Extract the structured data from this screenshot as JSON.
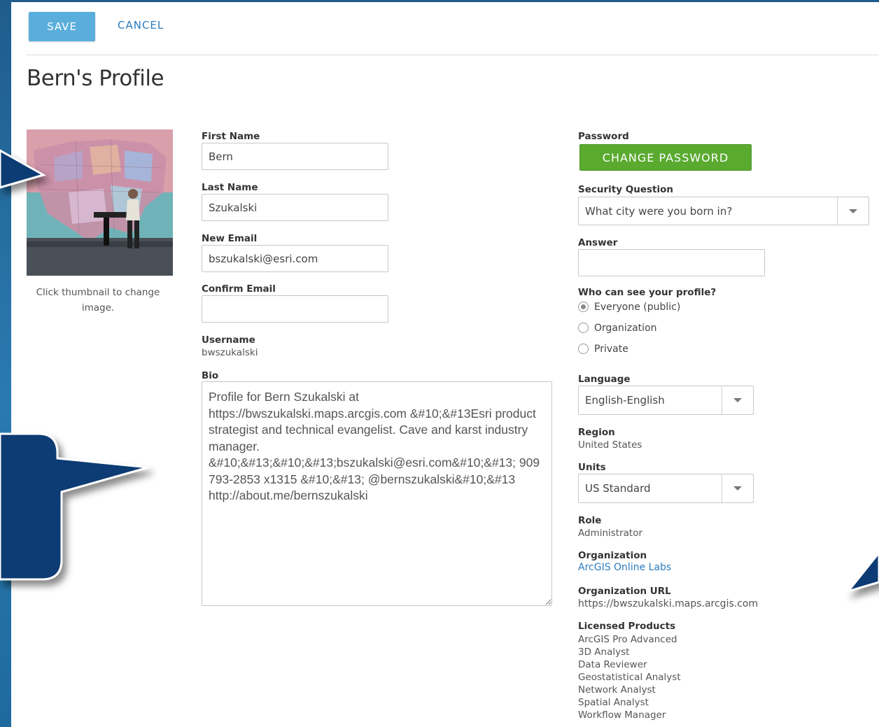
{
  "toolbar": {
    "save_label": "SAVE",
    "cancel_label": "CANCEL"
  },
  "page_title": "Bern's Profile",
  "thumbnail": {
    "caption": "Click thumbnail to change image."
  },
  "form": {
    "first_name": {
      "label": "First Name",
      "value": "Bern"
    },
    "last_name": {
      "label": "Last Name",
      "value": "Szukalski"
    },
    "new_email": {
      "label": "New Email",
      "value": "bszukalski@esri.com"
    },
    "confirm_email": {
      "label": "Confirm Email",
      "value": ""
    },
    "username": {
      "label": "Username",
      "value": "bwszukalski"
    },
    "bio": {
      "label": "Bio",
      "value": "Profile for Bern Szukalski at https://bwszukalski.maps.arcgis.com &#10;&#13Esri product strategist and technical evangelist. Cave and karst industry manager. &#10;&#13;&#10;&#13;bszukalski@esri.com&#10;&#13; 909 793-2853 x1315 &#10;&#13; @bernszukalski&#10;&#13 http://about.me/bernszukalski"
    }
  },
  "account": {
    "password": {
      "label": "Password",
      "button": "CHANGE PASSWORD"
    },
    "security_question": {
      "label": "Security Question",
      "selected": "What city were you born in?"
    },
    "answer": {
      "label": "Answer",
      "value": ""
    },
    "visibility": {
      "label": "Who can see your profile?",
      "options": [
        "Everyone (public)",
        "Organization",
        "Private"
      ],
      "selected": "Everyone (public)"
    },
    "language": {
      "label": "Language",
      "selected": "English-English"
    },
    "region": {
      "label": "Region",
      "value": "United States"
    },
    "units": {
      "label": "Units",
      "selected": "US Standard"
    },
    "role": {
      "label": "Role",
      "value": "Administrator"
    },
    "organization": {
      "label": "Organization",
      "value": "ArcGIS Online Labs"
    },
    "organization_url": {
      "label": "Organization URL",
      "value": "https://bwszukalski.maps.arcgis.com"
    },
    "licensed_products": {
      "label": "Licensed Products",
      "items": [
        "ArcGIS Pro Advanced",
        "3D Analyst",
        "Data Reviewer",
        "Geostatistical Analyst",
        "Network Analyst",
        "Spatial Analyst",
        "Workflow Manager"
      ]
    }
  },
  "colors": {
    "primary_button": "#5aaedc",
    "green_button": "#5aaa30",
    "link": "#2b7cbf",
    "callout": "#0e3a73"
  }
}
